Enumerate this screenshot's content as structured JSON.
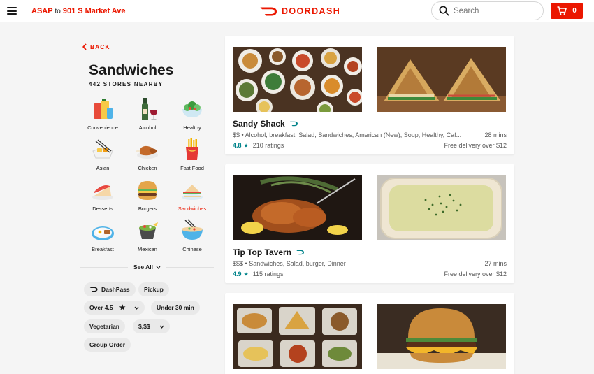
{
  "header": {
    "address_prefix": "ASAP",
    "address_to": "to",
    "address_value": "901 S Market Ave",
    "logo_text": "DOORDASH",
    "search_placeholder": "Search",
    "cart_count": "0"
  },
  "colors": {
    "brand": "#eb1700",
    "rating_teal": "#00838a"
  },
  "sidebar": {
    "back_label": "BACK",
    "title": "Sandwiches",
    "stores_nearby": "442 STORES NEARBY",
    "categories": [
      {
        "label": "Convenience",
        "icon": "convenience-icon"
      },
      {
        "label": "Alcohol",
        "icon": "alcohol-icon"
      },
      {
        "label": "Healthy",
        "icon": "healthy-icon"
      },
      {
        "label": "Asian",
        "icon": "asian-icon"
      },
      {
        "label": "Chicken",
        "icon": "chicken-icon"
      },
      {
        "label": "Fast Food",
        "icon": "fast-food-icon"
      },
      {
        "label": "Desserts",
        "icon": "desserts-icon"
      },
      {
        "label": "Burgers",
        "icon": "burgers-icon"
      },
      {
        "label": "Sandwiches",
        "icon": "sandwiches-icon",
        "active": true
      },
      {
        "label": "Breakfast",
        "icon": "breakfast-icon"
      },
      {
        "label": "Mexican",
        "icon": "mexican-icon"
      },
      {
        "label": "Chinese",
        "icon": "chinese-icon"
      }
    ],
    "see_all": "See All",
    "filters": {
      "dashpass": "DashPass",
      "pickup": "Pickup",
      "over_rating": "Over 4.5",
      "under_30": "Under 30 min",
      "vegetarian": "Vegetarian",
      "price": "$,$$",
      "group_order": "Group Order"
    }
  },
  "restaurants": [
    {
      "name": "Sandy Shack",
      "price": "$$",
      "cuisines": "Alcohol, breakfast, Salad, Sandwiches, American (New), Soup, Healthy, Caf...",
      "time": "28 mins",
      "rating": "4.8",
      "ratings_count": "210 ratings",
      "delivery": "Free delivery over $12",
      "images": [
        "food-spread-photo",
        "panini-photo"
      ]
    },
    {
      "name": "Tip Top Tavern",
      "price": "$$$",
      "cuisines": "Sandwiches, Salad, burger, Dinner",
      "time": "27 mins",
      "rating": "4.9",
      "ratings_count": "115 ratings",
      "delivery": "Free delivery over $12",
      "images": [
        "fried-chicken-photo",
        "soup-photo"
      ]
    },
    {
      "images": [
        "food-trays-photo",
        "burger-photo"
      ]
    }
  ]
}
